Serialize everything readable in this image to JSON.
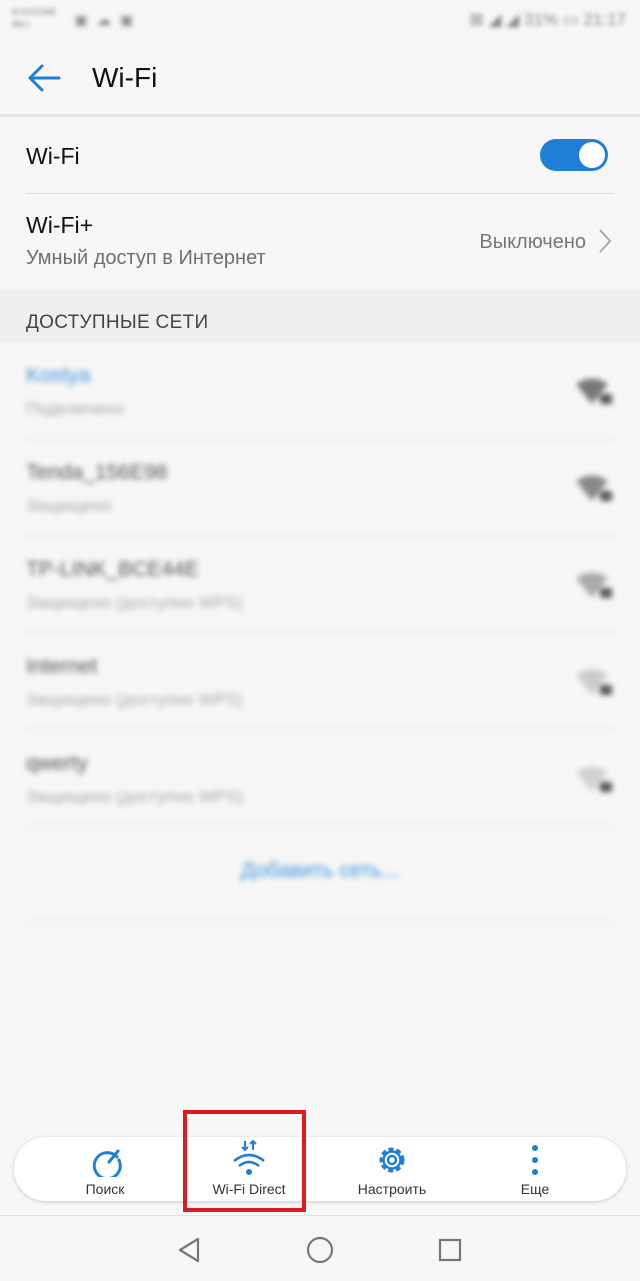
{
  "status_bar": {
    "carrier_line1": "KYIVSTAR",
    "carrier_line2": "life:)",
    "left_icons": "▣ ☁ ▣",
    "right": "⊠ ◢ ◢ 31% ▭ 21:17"
  },
  "header": {
    "title": "Wi-Fi"
  },
  "settings": {
    "wifi": {
      "label": "Wi-Fi",
      "enabled": true
    },
    "wifi_plus": {
      "label": "Wi-Fi+",
      "subtitle": "Умный доступ в Интернет",
      "value": "Выключено"
    }
  },
  "section": {
    "available_networks": "ДОСТУПНЫЕ СЕТИ"
  },
  "networks": [
    {
      "name": "Kostya",
      "status": "Подключено"
    },
    {
      "name": "Tenda_156E98",
      "status": "Защищено"
    },
    {
      "name": "TP-LINK_BCE44E",
      "status": "Защищено (доступно WPS)"
    },
    {
      "name": "Internet",
      "status": "Защищено (доступно WPS)"
    },
    {
      "name": "qwerty",
      "status": "Защищено (доступно WPS)"
    }
  ],
  "add_network": "Добавить сеть...",
  "bottom_bar": {
    "items": [
      {
        "label": "Поиск",
        "icon": "refresh-icon"
      },
      {
        "label": "Wi-Fi Direct",
        "icon": "wifi-direct-icon"
      },
      {
        "label": "Настроить",
        "icon": "gear-icon"
      },
      {
        "label": "Еще",
        "icon": "more-vertical-icon"
      }
    ]
  },
  "colors": {
    "accent": "#1f7fd6",
    "highlight": "#e01b1b"
  }
}
